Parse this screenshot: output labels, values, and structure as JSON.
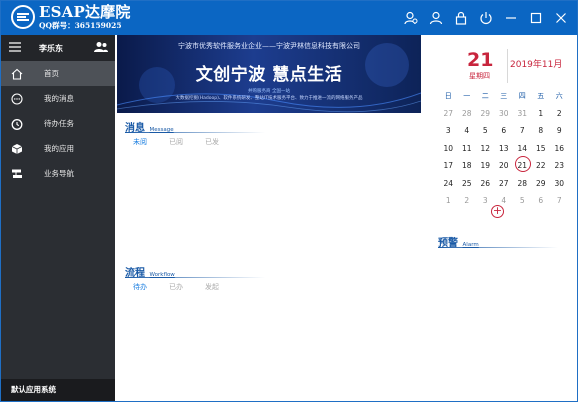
{
  "app": {
    "brand_name": "ESAP达摩院",
    "qq_label": "QQ群号：365159025"
  },
  "titlebar_icons": [
    "user-settings-icon",
    "user-icon",
    "lock-icon",
    "power-icon",
    "minimize-icon",
    "maximize-icon",
    "close-icon"
  ],
  "sidebar": {
    "user": "李乐东",
    "items": [
      {
        "label": "首页",
        "icon": "home-icon",
        "active": true
      },
      {
        "label": "我的消息",
        "icon": "message-icon",
        "active": false
      },
      {
        "label": "待办任务",
        "icon": "clock-icon",
        "active": false
      },
      {
        "label": "我的应用",
        "icon": "cube-icon",
        "active": false
      },
      {
        "label": "业务导航",
        "icon": "navigation-icon",
        "active": false
      }
    ],
    "footer": "默认应用系统"
  },
  "banner": {
    "top_line": "宁波市优秀软件服务业企业——宁波尹林信息科技有限公司",
    "title": "文创宁波 慧点生活",
    "sub_line": "并购服务商 全国一站",
    "small_line": "大数据挖掘(Hadoop)、软件系统研发、整站IT技术服务平台、致力于推进一流的网络服务产品"
  },
  "message": {
    "title": "消息",
    "title_en": "Message",
    "tabs": [
      "未阅",
      "已阅",
      "已发"
    ]
  },
  "workflow": {
    "title": "流程",
    "title_en": "Workflow",
    "tabs": [
      "待办",
      "已办",
      "发起"
    ]
  },
  "calendar": {
    "day": "21",
    "weekday": "星期四",
    "month": "2019年11月",
    "week_headers": [
      "日",
      "一",
      "二",
      "三",
      "四",
      "五",
      "六"
    ],
    "rows": [
      [
        {
          "d": "27",
          "m": true
        },
        {
          "d": "28",
          "m": true
        },
        {
          "d": "29",
          "m": true
        },
        {
          "d": "30",
          "m": true
        },
        {
          "d": "31",
          "m": true
        },
        {
          "d": "1"
        },
        {
          "d": "2"
        }
      ],
      [
        {
          "d": "3"
        },
        {
          "d": "4"
        },
        {
          "d": "5"
        },
        {
          "d": "6"
        },
        {
          "d": "7"
        },
        {
          "d": "8"
        },
        {
          "d": "9"
        }
      ],
      [
        {
          "d": "10"
        },
        {
          "d": "11"
        },
        {
          "d": "12"
        },
        {
          "d": "13"
        },
        {
          "d": "14"
        },
        {
          "d": "15"
        },
        {
          "d": "16"
        }
      ],
      [
        {
          "d": "17"
        },
        {
          "d": "18"
        },
        {
          "d": "19"
        },
        {
          "d": "20"
        },
        {
          "d": "21",
          "today": true
        },
        {
          "d": "22"
        },
        {
          "d": "23"
        }
      ],
      [
        {
          "d": "24"
        },
        {
          "d": "25"
        },
        {
          "d": "26"
        },
        {
          "d": "27"
        },
        {
          "d": "28"
        },
        {
          "d": "29"
        },
        {
          "d": "30"
        }
      ],
      [
        {
          "d": "1",
          "m": true
        },
        {
          "d": "2",
          "m": true
        },
        {
          "d": "3",
          "m": true
        },
        {
          "d": "4",
          "m": true
        },
        {
          "d": "5",
          "m": true
        },
        {
          "d": "6",
          "m": true
        },
        {
          "d": "7",
          "m": true
        }
      ]
    ],
    "add_label": "+"
  },
  "alarm": {
    "title": "预警",
    "title_en": "Alarm"
  },
  "colors": {
    "titlebar": "#0b66c3",
    "sidebar": "#2b2e33",
    "accent_red": "#c8253d",
    "accent_blue": "#1a5aa6"
  }
}
